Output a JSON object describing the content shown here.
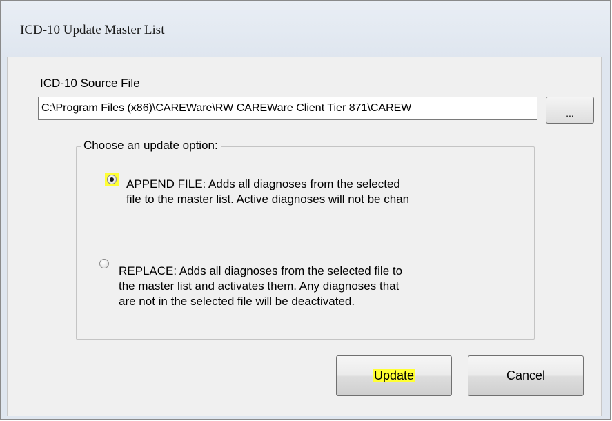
{
  "window": {
    "title": "ICD-10 Update Master List"
  },
  "source": {
    "label": "ICD-10 Source File",
    "path_value": "C:\\Program Files (x86)\\CAREWare\\RW CAREWare Client Tier 871\\CAREW",
    "browse_label": "..."
  },
  "options": {
    "group_label": "Choose an update option:",
    "append": {
      "line1": "APPEND FILE: Adds all diagnoses from the selected",
      "line2": "file to the master list. Active diagnoses will not be chan",
      "selected": true
    },
    "replace": {
      "line1": "REPLACE: Adds all diagnoses from the selected file to",
      "line2": "the master list and activates them. Any diagnoses that",
      "line3": "are not in the selected file will be deactivated.",
      "selected": false
    }
  },
  "buttons": {
    "update_label": "Update",
    "cancel_label": "Cancel"
  },
  "colors": {
    "highlight": "#ffff33",
    "titlebar": "#dfe6ef",
    "client": "#f0f0f0"
  }
}
